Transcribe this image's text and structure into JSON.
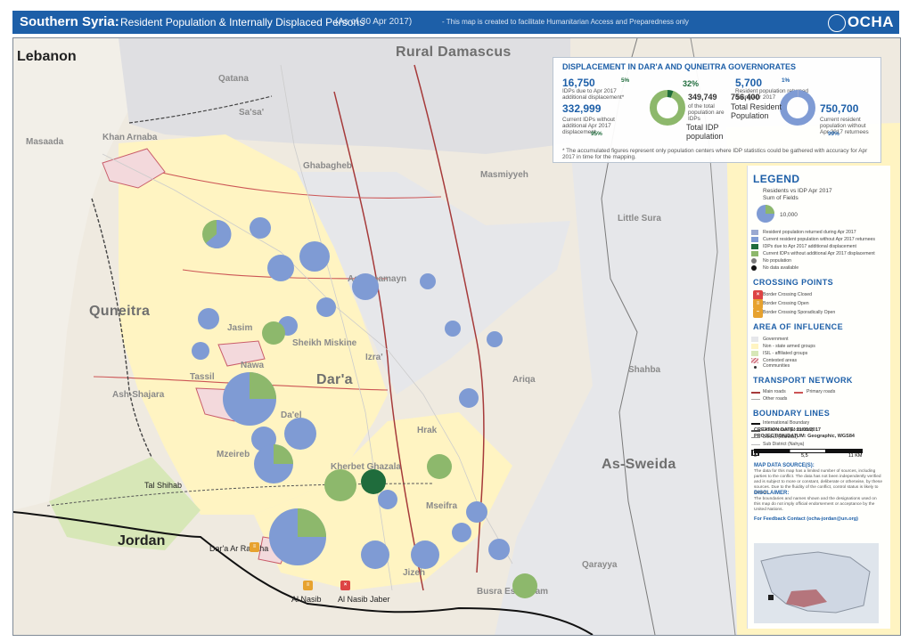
{
  "header": {
    "title_bold": "Southern Syria:",
    "title_rest": "Resident Population & Internally Displaced Persons",
    "date": "(As of 30 Apr 2017)",
    "subtitle": "- This map is created to facilitate Humanitarian Access and Preparedness only",
    "brand": "OCHA"
  },
  "countries": [
    "Lebanon",
    "Jordan"
  ],
  "governorates": [
    "Rural Damascus",
    "Quneitra",
    "Dar'a",
    "As-Sweida"
  ],
  "districts": [
    "Qatana",
    "Sa'sa'",
    "Masaada",
    "Arnaba",
    "Khan",
    "Ghabagheb",
    "As-Sanamayn",
    "Izra'",
    "Jasim",
    "Nawa",
    "Sheikh Miskine",
    "Tassil",
    "Da'el",
    "Ash-Shajara",
    "Mzeireb",
    "Kherbet Ghazala",
    "Mseifra",
    "Busra Esh-Sham",
    "Jizeh",
    "Shahba",
    "Ariqa",
    "Qarayya",
    "Hrak",
    "Masmiyyeh",
    "Little Sura"
  ],
  "crossings": [
    "Tal Shihab",
    "Dar'a Ar Ramtha",
    "Al Nasib",
    "Al Nasib Jaber"
  ],
  "displacement_panel": {
    "title": "DISPLACEMENT IN DAR'A AND QUNEITRA GOVERNORATES",
    "left_top_value": "16,750",
    "left_top_pct": "5%",
    "left_top_label": "IDPs due to Apr 2017 additional displacement*",
    "left_total_value": "349,749",
    "left_total_label": "of the total population are IDPs",
    "left_total_pct": "32%",
    "left_bottom_value": "332,999",
    "left_bottom_label": "Current IDPs without additional Apr 2017 displacement",
    "left_bottom_pct": "95%",
    "center_label1": "Total IDP",
    "center_label2": "population",
    "right_top_value": "5,700",
    "right_top_pct": "1%",
    "right_top_label": "Resident population returned during Apr 2017",
    "right_total_value": "756,400",
    "right_total_label1": "Total Resident",
    "right_total_label2": "Population",
    "right_bottom_value": "750,700",
    "right_bottom_label": "Current resident population without Apr 2017 returnees",
    "right_bottom_pct": "99%",
    "footnote": "* The accumulated figures represent only population centers where IDP statistics could be gathered with accuracy for Apr 2017 in time for the mapping."
  },
  "legend": {
    "title": "LEGEND",
    "sub1": "Residents vs IDP Apr 2017",
    "sub2": "Sum of Fields",
    "scale_value": "10,000",
    "items": [
      {
        "label": "Resident population returned during Apr 2017",
        "color": "#9aa9d1"
      },
      {
        "label": "Current resident population without Apr 2017 returnees",
        "color": "#7f9bd4"
      },
      {
        "label": "IDPs due to Apr 2017 additional displacement",
        "color": "#1f6c3c"
      },
      {
        "label": "Current IDPs without additional Apr 2017 displacement",
        "color": "#8db86c"
      },
      {
        "label": "No population",
        "color": "#7a7a7a"
      },
      {
        "label": "No data available",
        "color": "#111111"
      }
    ],
    "crossing_title": "CROSSING POINTS",
    "crossing_items": [
      "Border Crossing Closed",
      "Border Crossing Open",
      "Border Crossing Sporadically Open"
    ],
    "aoi_title": "AREA OF INFLUENCE",
    "aoi_items": [
      "Government",
      "Non - state armed groups",
      "ISIL - affiliated groups",
      "Contested areas",
      "Communities"
    ],
    "transport_title": "TRANSPORT NETWORK",
    "transport_items": [
      "Main roads",
      "Primary roads",
      "Other roads"
    ],
    "boundary_title": "BOUNDARY LINES",
    "boundary_items": [
      "International Boundary",
      "Governorate (Mohafaza)",
      "District (Mantika)",
      "Sub District (Nahya)",
      "UNDOF Administered Area"
    ]
  },
  "footer": {
    "creation": "CREATION DATE: 11/05/2017",
    "projection": "PROJECTION/DATUM: Geographic, WGS84",
    "scale_labels": [
      "0",
      "5,5",
      "11 KM"
    ],
    "data_sources_title": "MAP DATA SOURCE(S):",
    "data_sources_text": "The data for this map has a limited number of sources, including parties to the conflict. The data has not been independently verified and is subject to more or constant, deliberate or otherwise, by these sources. Due to the fluidity of the conflict, control status is likely to change.",
    "disclaimer_title": "DISCLAIMER:",
    "disclaimer_text": "The boundaries and names shown and the designations used on this map do not imply official endorsement or acceptance by the United Nations.",
    "feedback": "For Feedback Contact (ocha-jordan@un.org)"
  },
  "colors": {
    "resident_return": "#9aa9d1",
    "resident_current": "#7f9bd4",
    "idp_new": "#1f6c3c",
    "idp_current": "#8db86c",
    "government_area": "#e6e7ea",
    "nsag_area": "#fff4c2",
    "isil_area": "#d7e7b7"
  }
}
